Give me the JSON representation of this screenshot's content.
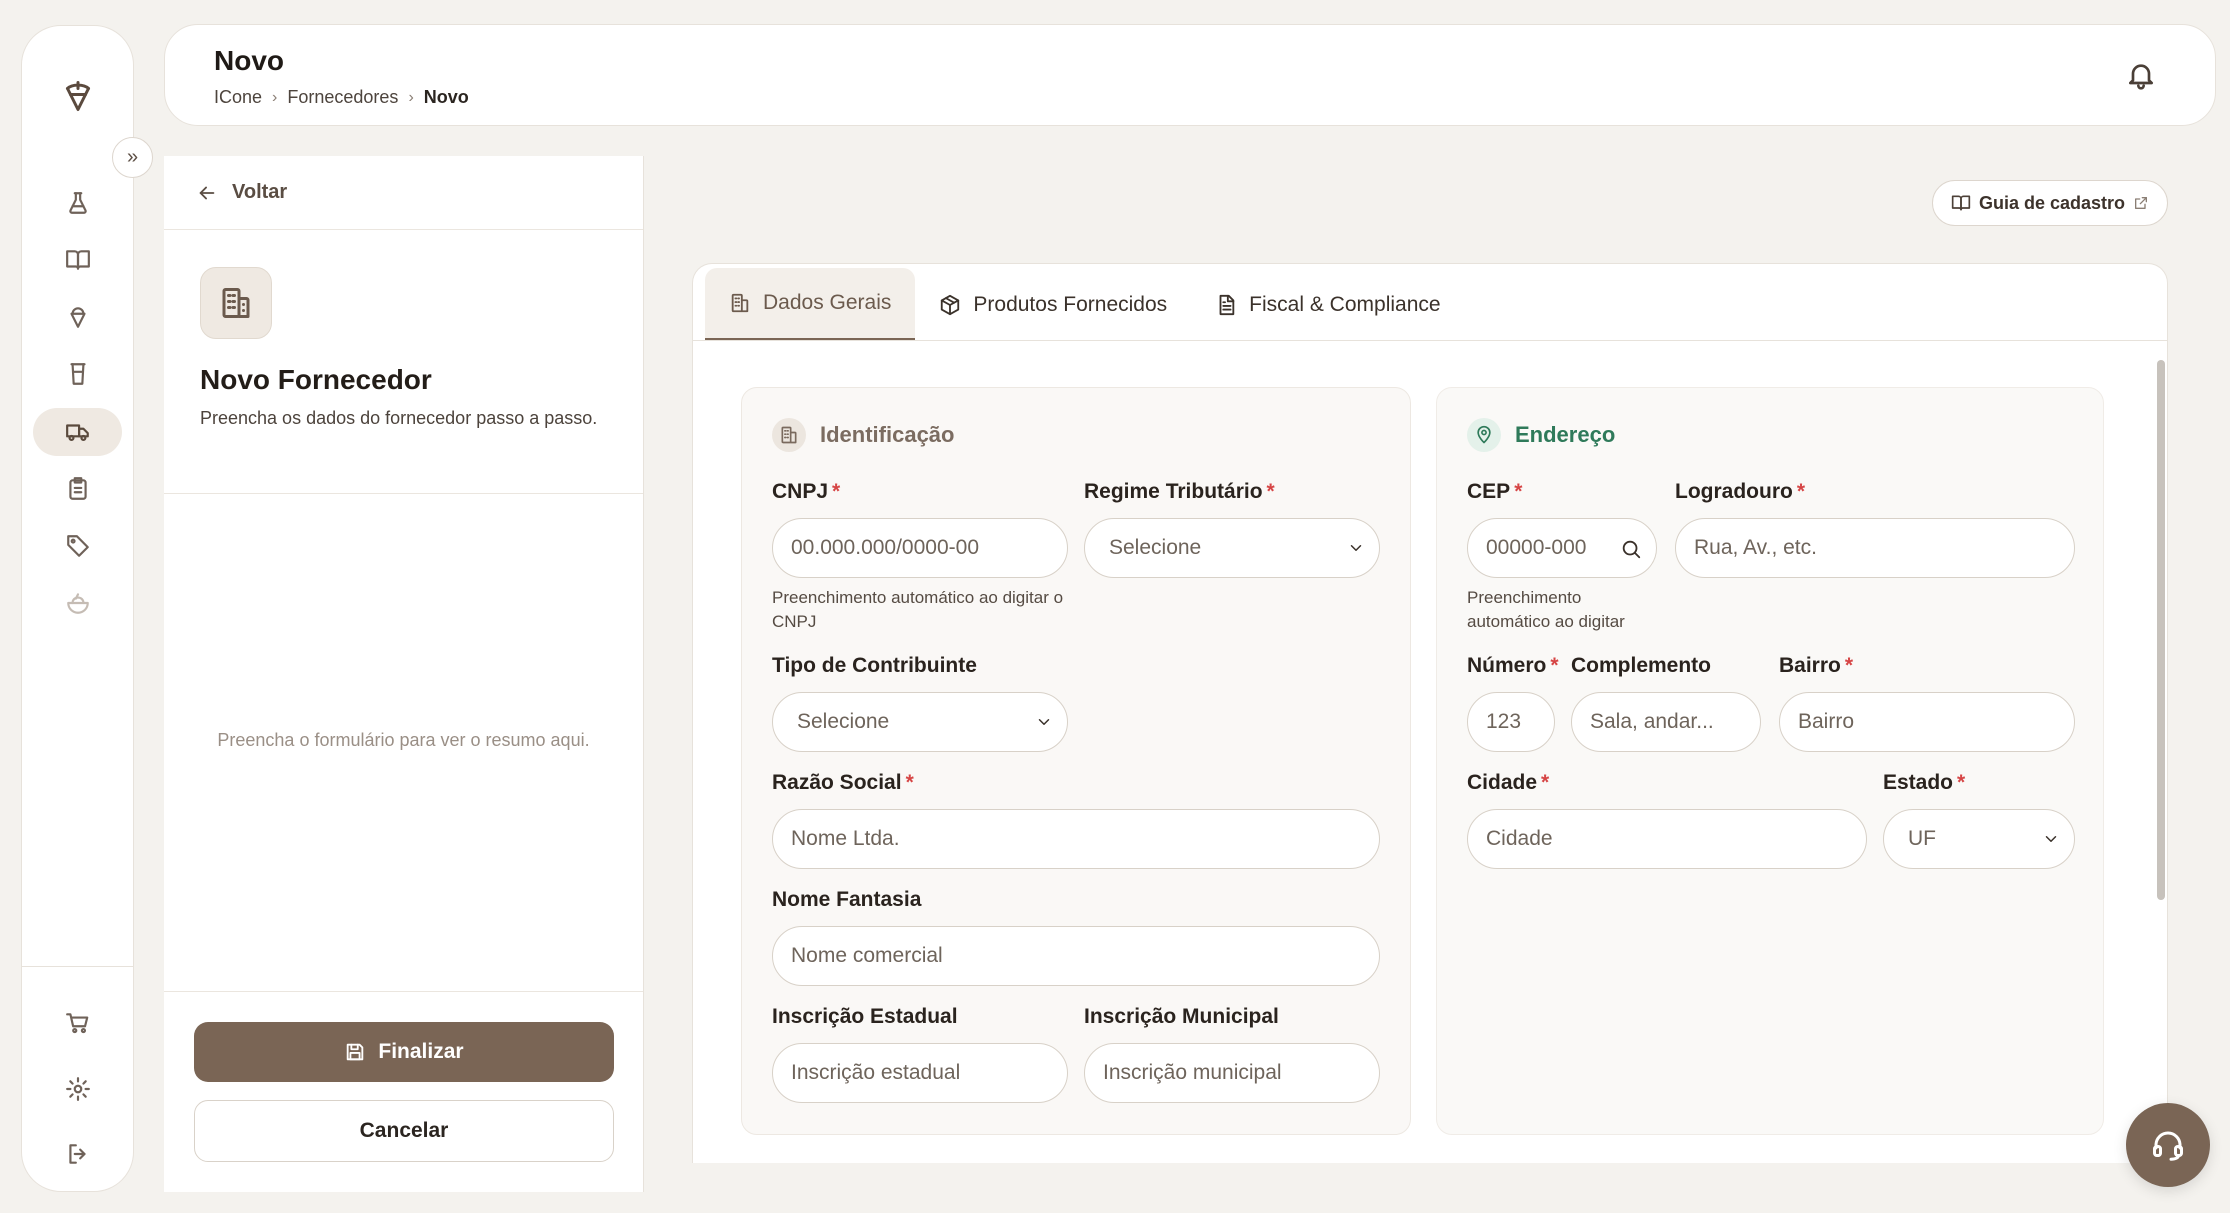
{
  "header": {
    "title": "Novo",
    "breadcrumb": [
      "ICone",
      "Fornecedores",
      "Novo"
    ]
  },
  "sidebar": {
    "items": [
      {
        "icon": "flask-icon"
      },
      {
        "icon": "book-open-icon"
      },
      {
        "icon": "ice-cream-icon"
      },
      {
        "icon": "glass-icon"
      },
      {
        "icon": "truck-icon",
        "active": true
      },
      {
        "icon": "clipboard-icon"
      },
      {
        "icon": "tag-icon"
      },
      {
        "icon": "salad-bowl-icon",
        "faded": true
      }
    ],
    "bottom_items": [
      {
        "icon": "cart-icon"
      },
      {
        "icon": "gear-icon"
      },
      {
        "icon": "logout-icon"
      }
    ]
  },
  "left_panel": {
    "back_label": "Voltar",
    "title": "Novo Fornecedor",
    "description": "Preencha os dados do fornecedor passo a passo.",
    "summary_empty": "Preencha o formulário para ver o resumo aqui.",
    "finalize_label": "Finalizar",
    "cancel_label": "Cancelar"
  },
  "guide_button": "Guia de cadastro",
  "tabs": [
    {
      "label": "Dados Gerais",
      "active": true
    },
    {
      "label": "Produtos Fornecidos"
    },
    {
      "label": "Fiscal & Compliance"
    }
  ],
  "identificacao": {
    "title": "Identificação",
    "cnpj": {
      "label": "CNPJ",
      "placeholder": "00.000.000/0000-00",
      "hint": "Preenchimento automático ao digitar o CNPJ"
    },
    "regime": {
      "label": "Regime Tributário",
      "value": "Selecione"
    },
    "tipo": {
      "label": "Tipo de Contribuinte",
      "value": "Selecione"
    },
    "razao": {
      "label": "Razão Social",
      "placeholder": "Nome Ltda."
    },
    "fantasia": {
      "label": "Nome Fantasia",
      "placeholder": "Nome comercial"
    },
    "ie": {
      "label": "Inscrição Estadual",
      "placeholder": "Inscrição estadual"
    },
    "im": {
      "label": "Inscrição Municipal",
      "placeholder": "Inscrição municipal"
    }
  },
  "endereco": {
    "title": "Endereço",
    "cep": {
      "label": "CEP",
      "placeholder": "00000-000",
      "hint": "Preenchimento automático ao digitar"
    },
    "logradouro": {
      "label": "Logradouro",
      "placeholder": "Rua, Av., etc."
    },
    "numero": {
      "label": "Número",
      "placeholder": "123"
    },
    "complemento": {
      "label": "Complemento",
      "placeholder": "Sala, andar..."
    },
    "bairro": {
      "label": "Bairro",
      "placeholder": "Bairro"
    },
    "cidade": {
      "label": "Cidade",
      "placeholder": "Cidade"
    },
    "estado": {
      "label": "Estado",
      "value": "UF"
    }
  },
  "colors": {
    "accent": "#7a6555",
    "required": "#d64545",
    "address_green": "#2f7a5a"
  }
}
